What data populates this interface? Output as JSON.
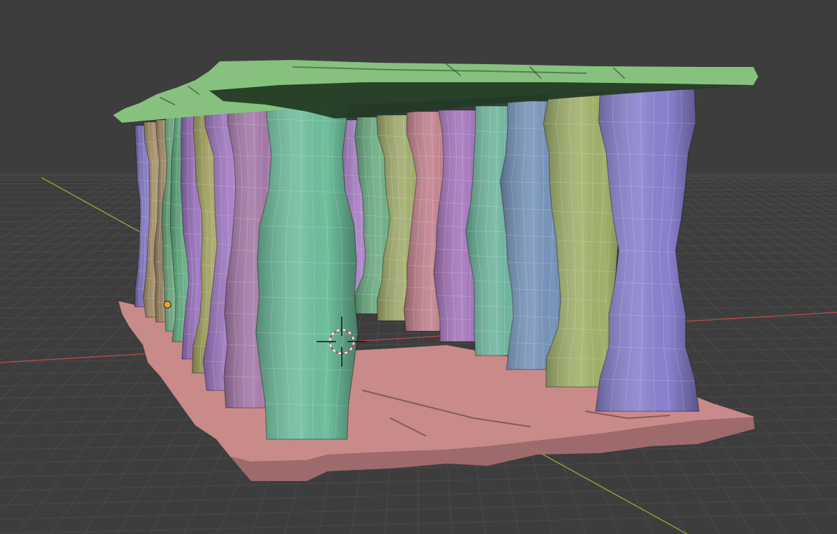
{
  "viewport": {
    "background_color": "#3d3d3d",
    "grid_color": "#4a4a4a",
    "x_axis_color": "#b24a4a",
    "y_axis_color": "#8aa53a",
    "view_mode": "solid-shading-random-object-colors",
    "wireframe_overlay": true
  },
  "objects": {
    "floor_slab": {
      "color": "#c98a8a"
    },
    "roof_slab": {
      "color": "#86c27e"
    },
    "pillar_colors": [
      "#7d72c0",
      "#a89068",
      "#9b8560",
      "#6aad7f",
      "#5fae82",
      "#9a6fbf",
      "#a7a762",
      "#a079c4",
      "#a57aa9",
      "#6fbf9d",
      "#6ab4a6",
      "#a77cc4",
      "#6cae82",
      "#a2ad6c",
      "#c3828e",
      "#a777be",
      "#6fb7a0",
      "#7895bc",
      "#a2b26c",
      "#8a82d0"
    ]
  },
  "gizmos": {
    "3d_cursor": "crosshair-cursor-icon",
    "origin_dot": "origin-dot-icon",
    "origin_dot_color": "#f0a030"
  }
}
